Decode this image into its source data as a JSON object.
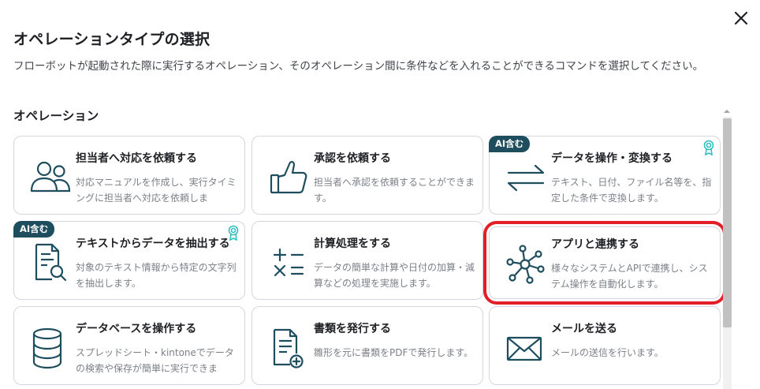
{
  "dialog": {
    "title": "オペレーションタイプの選択",
    "description": "フローボットが起動された際に実行するオペレーション、そのオペレーション間に条件などを入れることができるコマンドを選択してください。",
    "close_icon": "close-icon"
  },
  "section": {
    "title": "オペレーション"
  },
  "cards": [
    {
      "title": "担当者へ対応を依頼する",
      "description": "対応マニュアルを作成し、実行タイミングに担当者へ対応を依頼しま",
      "icon": "users-icon"
    },
    {
      "title": "承認を依頼する",
      "description": "担当者へ承認を依頼することができます。",
      "icon": "thumbs-up-icon"
    },
    {
      "title": "データを操作・変換する",
      "description": "テキスト、日付、ファイル名等を、指定した条件で変換します。",
      "icon": "convert-arrows-icon",
      "badge": "AI含む",
      "award": true
    },
    {
      "title": "テキストからデータを抽出する",
      "description": "対象のテキスト情報から特定の文字列を抽出します。",
      "icon": "document-search-icon",
      "badge": "AI含む",
      "award": true
    },
    {
      "title": "計算処理をする",
      "description": "データの簡単な計算や日付の加算・減算などの処理を実施します。",
      "icon": "calculator-icon"
    },
    {
      "title": "アプリと連携する",
      "description": "様々なシステムとAPIで連携し、システム操作を自動化します。",
      "icon": "network-hub-icon",
      "highlighted": true
    },
    {
      "title": "データベースを操作する",
      "description": "スプレッドシート・kintoneでデータの検索や保存が簡単に実行できま",
      "icon": "database-icon"
    },
    {
      "title": "書類を発行する",
      "description": "雛形を元に書類をPDFで発行します。",
      "icon": "document-add-icon"
    },
    {
      "title": "メールを送る",
      "description": "メールの送信を行います。",
      "icon": "mail-icon"
    }
  ],
  "colors": {
    "accent": "#1e4e5e",
    "highlight": "#e21f26",
    "award": "#2fbfbf",
    "border": "#d3d6dc"
  }
}
